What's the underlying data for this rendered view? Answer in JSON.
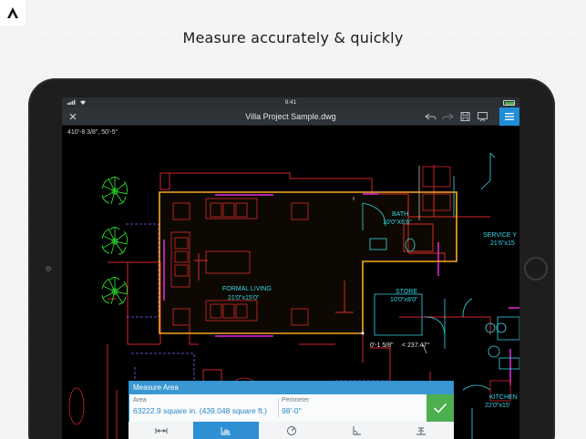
{
  "headline": "Measure accurately & quickly",
  "icons": {
    "brand": "autodesk-logo-icon",
    "close": "close-icon",
    "undo": "undo-icon",
    "redo": "redo-icon",
    "save": "save-icon",
    "present": "present-icon",
    "menu": "menu-icon",
    "confirm": "checkmark-icon"
  },
  "status_bar": {
    "time": "9:41"
  },
  "toolbar": {
    "title": "Villa Project Sample.dwg"
  },
  "coord_readout": "410'-8 3/8\",  50'-5\"",
  "drawing_labels": {
    "formal_living_name": "FORMAL LIVING",
    "formal_living_dim": "21'0\"x15'0\"",
    "bath_name": "BATH",
    "bath_dim": "10'0\"X6'6\"",
    "store_name": "STORE",
    "store_dim": "10'0\"x8'0\"",
    "service_name": "SERVICE Y",
    "service_dim": "21'6\"x15",
    "kitchen_name": "KITCHEN",
    "kitchen_dim": "22'0\"x15'",
    "segment_length": "0'-1 5/8\"",
    "segment_angle": "< 237.47°"
  },
  "measure_panel": {
    "title": "Measure Area",
    "area_label": "Area",
    "area_value": "63222.9 square in. (439.048 square ft.)",
    "perimeter_label": "Perimeter",
    "perimeter_value": "98'-0\""
  },
  "bottom_tools": [
    {
      "name": "measure-distance-tool",
      "icon": "ruler-distance-icon",
      "active": false
    },
    {
      "name": "measure-area-tool",
      "icon": "area-icon",
      "active": true
    },
    {
      "name": "measure-radius-tool",
      "icon": "radius-icon",
      "active": false
    },
    {
      "name": "measure-angle-tool",
      "icon": "angle-icon",
      "active": false
    },
    {
      "name": "measure-arc-tool",
      "icon": "arc-icon",
      "active": false
    }
  ],
  "colors": {
    "accent": "#2e8fd2",
    "confirm": "#4caf50",
    "measure_outline": "#f7a823",
    "wall_red": "#d6232c",
    "door_magenta": "#e628e6",
    "fixture_cyan": "#35d7e6",
    "tree_green": "#2bd62b"
  }
}
